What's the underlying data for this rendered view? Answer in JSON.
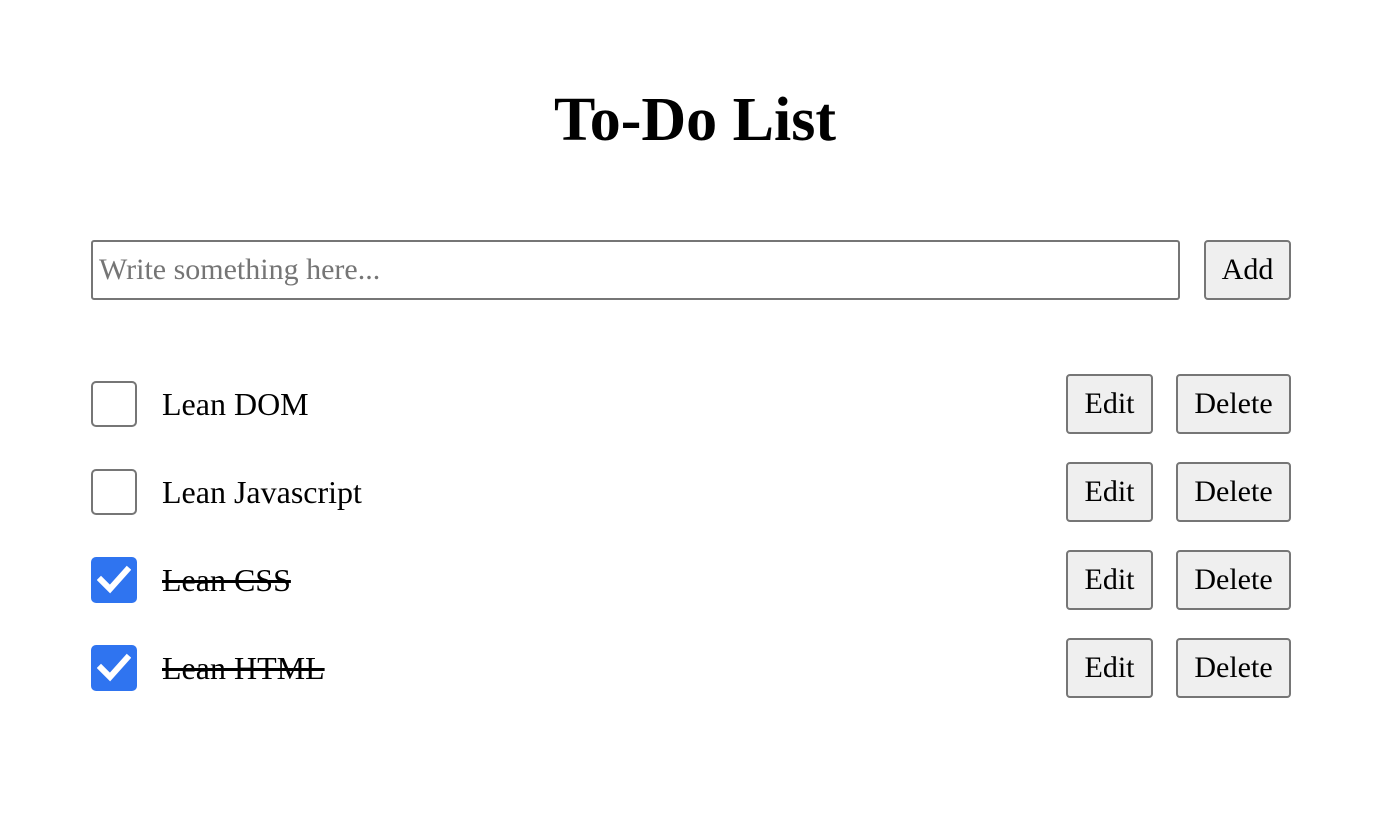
{
  "title": "To-Do List",
  "new_todo": {
    "placeholder": "Write something here...",
    "value": "",
    "add_label": "Add"
  },
  "todos": [
    {
      "text": "Lean DOM",
      "done": false,
      "edit_label": "Edit",
      "delete_label": "Delete"
    },
    {
      "text": "Lean Javascript",
      "done": false,
      "edit_label": "Edit",
      "delete_label": "Delete"
    },
    {
      "text": "Lean CSS",
      "done": true,
      "edit_label": "Edit",
      "delete_label": "Delete"
    },
    {
      "text": "Lean HTML",
      "done": true,
      "edit_label": "Edit",
      "delete_label": "Delete"
    }
  ],
  "colors": {
    "checkbox_checked": "#2f74f0",
    "button_bg": "#efefef",
    "border": "#767676"
  }
}
